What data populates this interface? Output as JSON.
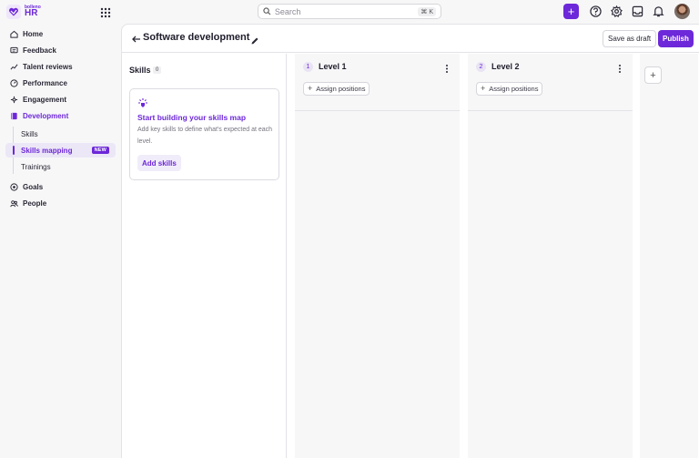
{
  "brand": {
    "name_small": "bolleno",
    "name_big": "HR"
  },
  "search": {
    "placeholder": "Search",
    "shortcut": "⌘ K"
  },
  "sidebar": {
    "items": [
      {
        "label": "Home"
      },
      {
        "label": "Feedback"
      },
      {
        "label": "Talent reviews"
      },
      {
        "label": "Performance"
      },
      {
        "label": "Engagement"
      },
      {
        "label": "Development"
      },
      {
        "label": "Goals"
      },
      {
        "label": "People"
      }
    ],
    "development_sub": [
      {
        "label": "Skills"
      },
      {
        "label": "Skills mapping",
        "badge": "NEW"
      },
      {
        "label": "Trainings"
      }
    ]
  },
  "header": {
    "title": "Software development",
    "save_draft_label": "Save as draft",
    "publish_label": "Publish"
  },
  "skills_panel": {
    "title": "Skills",
    "count": "0",
    "empty_title": "Start building your skills map",
    "empty_desc": "Add key skills to define what's expected at each level.",
    "add_button": "Add skills"
  },
  "levels": [
    {
      "num": "1",
      "name": "Level 1",
      "assign_label": "Assign positions"
    },
    {
      "num": "2",
      "name": "Level 2",
      "assign_label": "Assign positions"
    }
  ],
  "add_level_label": "+",
  "colors": {
    "accent": "#6d28d9",
    "accent_light": "#ece7f6"
  }
}
